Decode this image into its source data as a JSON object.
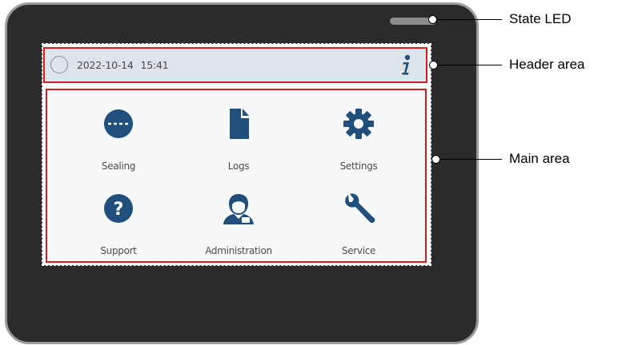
{
  "header": {
    "date": "2022-10-14",
    "time": "15:41"
  },
  "tiles": [
    {
      "label": "Sealing",
      "icon": "sealing-icon"
    },
    {
      "label": "Logs",
      "icon": "document-icon"
    },
    {
      "label": "Settings",
      "icon": "gear-icon"
    },
    {
      "label": "Support",
      "icon": "question-icon"
    },
    {
      "label": "Administration",
      "icon": "user-admin-icon"
    },
    {
      "label": "Service",
      "icon": "wrench-icon"
    }
  ],
  "callouts": {
    "state_led": "State LED",
    "header_area": "Header area",
    "main_area": "Main area"
  },
  "colors": {
    "device_body": "#2b2b2b",
    "icon_blue": "#1f4f7a",
    "highlight_red": "#d81b1b",
    "header_bg": "#dde4ea"
  }
}
